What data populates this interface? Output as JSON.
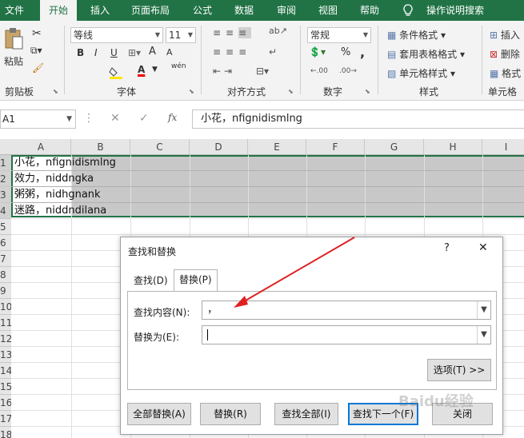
{
  "menu": {
    "tabs": [
      "文件",
      "开始",
      "插入",
      "页面布局",
      "公式",
      "数据",
      "审阅",
      "视图",
      "帮助"
    ],
    "active": "开始",
    "tell_me": "操作说明搜索"
  },
  "ribbon": {
    "clipboard": {
      "paste": "粘贴",
      "label": "剪贴板"
    },
    "font": {
      "name": "等线",
      "size": "11",
      "label": "字体",
      "bold": "B",
      "italic": "I",
      "underline": "U",
      "grow": "A",
      "shrink": "A",
      "phonetic": "wén"
    },
    "alignment": {
      "label": "对齐方式"
    },
    "number": {
      "format": "常规",
      "label": "数字",
      "percent": "%",
      "comma": ","
    },
    "styles": {
      "conditional": "条件格式",
      "table": "套用表格格式",
      "cell": "单元格样式",
      "label": "样式"
    },
    "cells": {
      "insert": "插入",
      "delete": "删除",
      "format": "格式",
      "label": "单元格"
    }
  },
  "formula": {
    "namebox": "A1",
    "fx": "fx",
    "content": "小花，nfignidismlng"
  },
  "grid": {
    "columns": [
      "A",
      "B",
      "C",
      "D",
      "E",
      "F",
      "G",
      "H",
      "I"
    ],
    "rows": [
      "1",
      "2",
      "3",
      "4",
      "5",
      "6",
      "7",
      "8",
      "9",
      "10",
      "11",
      "12",
      "13",
      "14",
      "15",
      "16",
      "17",
      "18"
    ],
    "cells": [
      "小花，nfignidismlng",
      "效力，niddngka",
      "粥粥，nidhgnank",
      "迷路，niddndilana"
    ]
  },
  "dialog": {
    "title": "查找和替换",
    "help": "?",
    "close": "✕",
    "tabs": [
      {
        "label": "查找(D)",
        "active": false
      },
      {
        "label": "替换(P)",
        "active": true
      }
    ],
    "find_label": "查找内容(N):",
    "find_value": "，",
    "replace_label": "替换为(E):",
    "replace_value": "",
    "options_button": "选项(T) >>",
    "buttons": {
      "replace_all": "全部替换(A)",
      "replace": "替换(R)",
      "find_all": "查找全部(I)",
      "find_next": "查找下一个(F)",
      "close": "关闭"
    }
  },
  "watermark": "Baidu经验",
  "colors": {
    "excel_green": "#217346",
    "selection": "#b4b4b4",
    "arrow": "#e02020",
    "focus_blue": "#0078d7"
  }
}
